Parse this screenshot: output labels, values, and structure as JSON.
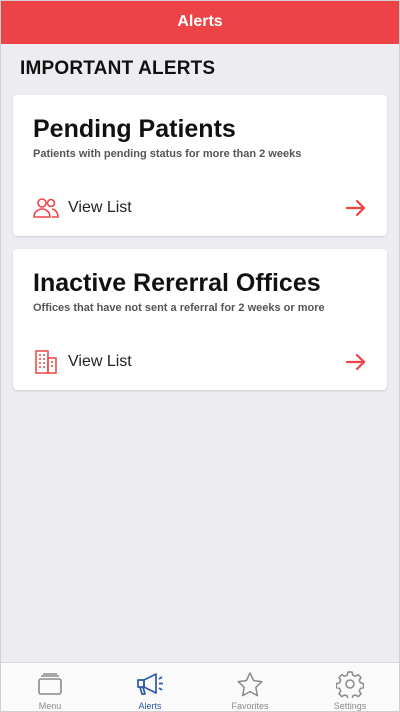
{
  "header": {
    "title": "Alerts"
  },
  "section": {
    "title": "IMPORTANT ALERTS"
  },
  "cards": [
    {
      "title": "Pending Patients",
      "subtitle": "Patients with pending status for more than 2 weeks",
      "link_label": "View List",
      "icon": "people-icon"
    },
    {
      "title": "Inactive Rererral Offices",
      "subtitle": "Offices that have not sent a referral for 2 weeks or more",
      "link_label": "View List",
      "icon": "building-icon"
    }
  ],
  "tabs": [
    {
      "label": "Menu",
      "icon": "menu-icon",
      "active": false
    },
    {
      "label": "Alerts",
      "icon": "megaphone-icon",
      "active": true
    },
    {
      "label": "Favorites",
      "icon": "star-icon",
      "active": false
    },
    {
      "label": "Settings",
      "icon": "gear-icon",
      "active": false
    }
  ],
  "colors": {
    "accent": "#ee4346",
    "active_tab": "#2d5aa8",
    "background": "#ececf1"
  }
}
